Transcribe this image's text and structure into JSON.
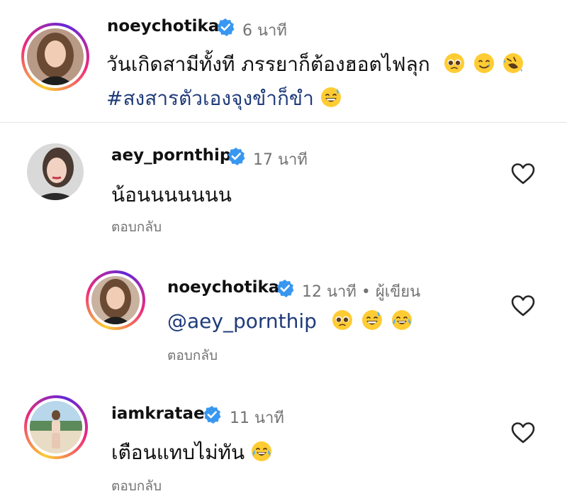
{
  "caption": {
    "username": "noeychotika",
    "time": "6 นาที",
    "line1": "วันเกิดสามีทั้งที ภรรยาก็ต้องฮอตไฟลุก",
    "line2": "#สงสารตัวเองจุงขำก็ขำ",
    "line1_emojis": [
      "pleading-face-emoji",
      "smiling-with-tear-emoji",
      "rolling-laughing-emoji"
    ],
    "line2_emojis": [
      "grinning-sweat-emoji"
    ]
  },
  "comments": [
    {
      "username": "aey_pornthip",
      "time": "17 นาที",
      "text": "น้อนนนนนนน",
      "reply_label": "ตอบกลับ"
    },
    {
      "username": "noeychotika",
      "time": "12 นาที • ผู้เขียน",
      "mention": "@aey_pornthip",
      "emojis": [
        "pleading-face-emoji",
        "grinning-sweat-emoji",
        "tears-of-joy-emoji"
      ],
      "reply_label": "ตอบกลับ"
    },
    {
      "username": "iamkratae",
      "time": "11 นาที",
      "text": "เตือนแทบไม่ทัน",
      "emojis": [
        "tears-of-joy-emoji"
      ],
      "reply_label": "ตอบกลับ"
    }
  ],
  "colors": {
    "verified": "#3897f0",
    "muted_text": "#737373",
    "mention": "#1f3b7a",
    "story_ring_start": "#f9ce34",
    "story_ring_mid": "#ee2a7b",
    "story_ring_end": "#6228d7"
  },
  "icons": [
    "verified-badge-icon",
    "heart-outline-icon"
  ]
}
